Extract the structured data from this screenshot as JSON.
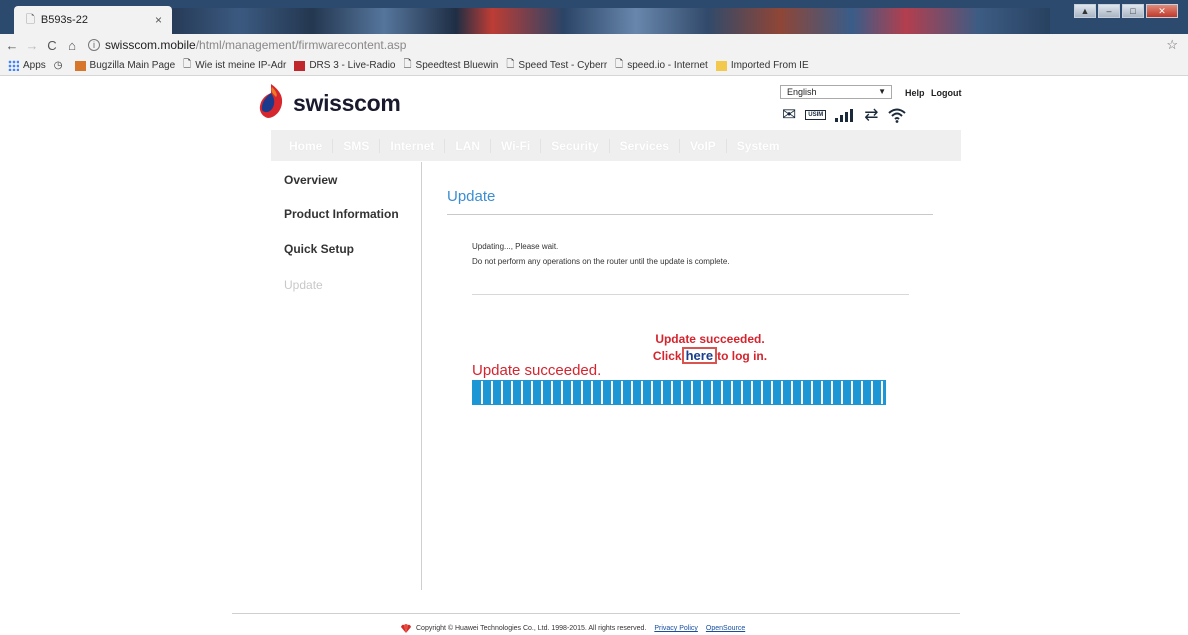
{
  "browser": {
    "tab_title": "B593s-22",
    "tab_close": "×",
    "url_host": "swisscom.mobile",
    "url_path": "/html/management/firmwarecontent.asp",
    "bookmarks": [
      "Apps",
      "Bugzilla Main Page",
      "Wie ist meine IP-Adr",
      "DRS 3 - Live-Radio",
      "Speedtest Bluewin",
      "Speed Test - Cyberr",
      "speed.io - Internet",
      "Imported From IE"
    ]
  },
  "header": {
    "logo_text": "swisscom",
    "language": "English",
    "help": "Help",
    "logout": "Logout"
  },
  "nav": [
    "Home",
    "SMS",
    "Internet",
    "LAN",
    "Wi-Fi",
    "Security",
    "Services",
    "VoIP",
    "System"
  ],
  "sidebar": {
    "items": [
      "Overview",
      "Product Information",
      "Quick Setup",
      "Update"
    ]
  },
  "main": {
    "title": "Update",
    "line1": "Updating..., Please wait.",
    "line2": "Do not perform any operations on the router until the update is complete.",
    "popup_line1": "Update succeeded.",
    "popup_click": "Click",
    "popup_link": "here",
    "popup_tail": "to log in.",
    "status": "Update succeeded.",
    "progress": 1.0
  },
  "footer": {
    "copyright": "Copyright © Huawei Technologies Co., Ltd. 1998-2015. All rights reserved.",
    "privacy": "Privacy Policy",
    "opensource": "OpenSource"
  },
  "colors": {
    "accent": "#3b8ed1",
    "progress": "#1d96d6",
    "alert": "#d4252e"
  }
}
